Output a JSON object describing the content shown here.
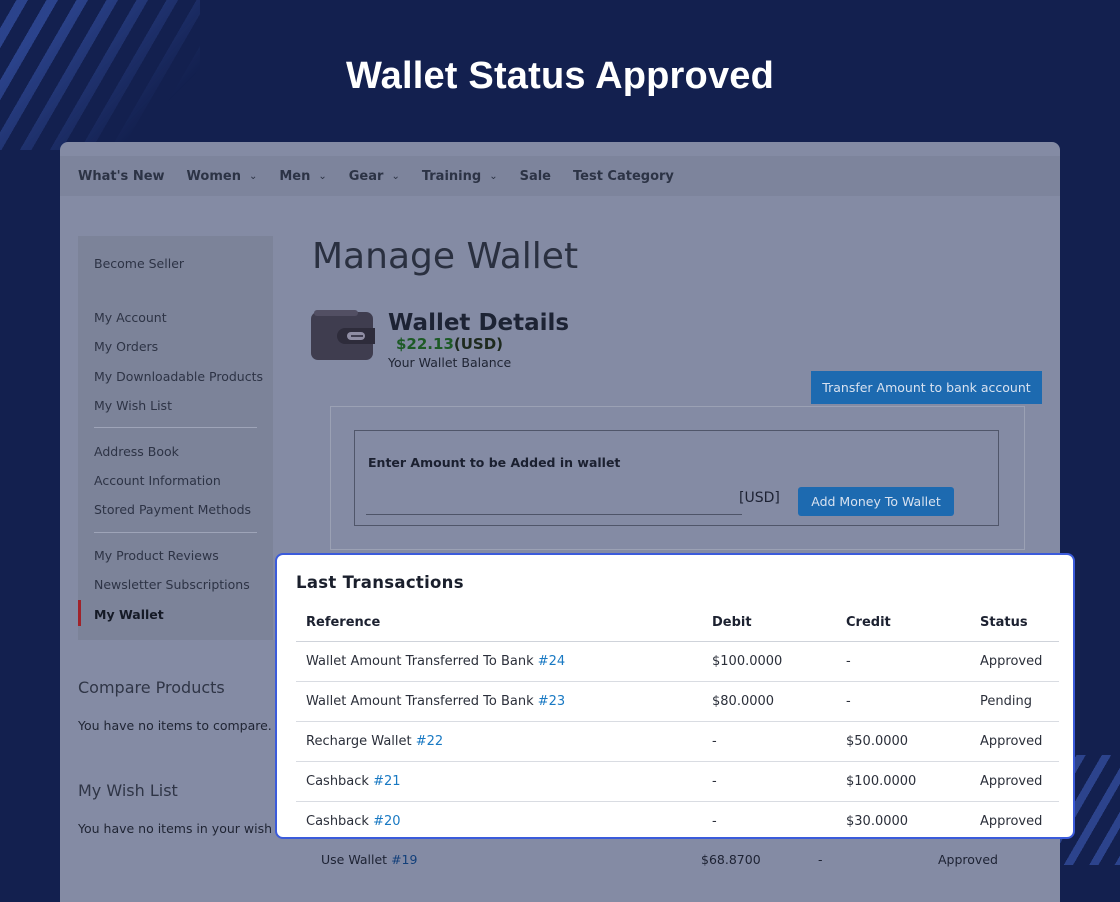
{
  "headline": "Wallet Status Approved",
  "nav": {
    "items": [
      {
        "label": "What's New",
        "dropdown": false
      },
      {
        "label": "Women",
        "dropdown": true
      },
      {
        "label": "Men",
        "dropdown": true
      },
      {
        "label": "Gear",
        "dropdown": true
      },
      {
        "label": "Training",
        "dropdown": true
      },
      {
        "label": "Sale",
        "dropdown": false
      },
      {
        "label": "Test Category",
        "dropdown": false
      }
    ]
  },
  "sidebar": {
    "become_seller": "Become Seller",
    "my_account": "My Account",
    "my_orders": "My Orders",
    "my_downloadable_products": "My Downloadable Products",
    "my_wish_list": "My Wish List",
    "address_book": "Address Book",
    "account_information": "Account Information",
    "stored_payment_methods": "Stored Payment Methods",
    "my_product_reviews": "My Product Reviews",
    "newsletter_subscriptions": "Newsletter Subscriptions",
    "my_wallet": "My Wallet"
  },
  "compare": {
    "heading": "Compare Products",
    "text": "You have no items to compare."
  },
  "wishlist": {
    "heading": "My Wish List",
    "text": "You have no items in your wish lis"
  },
  "page_title": "Manage Wallet",
  "wallet": {
    "title": "Wallet Details",
    "amount": "$22.13",
    "currency": "(USD)",
    "balance_label": "Your Wallet Balance",
    "transfer_button": "Transfer Amount to bank account",
    "amount_label": "Enter Amount to be Added in wallet",
    "amount_value": "",
    "usd_label": "[USD]",
    "add_button": "Add Money To Wallet"
  },
  "transactions": {
    "title": "Last Transactions",
    "headers": [
      "Reference",
      "Debit",
      "Credit",
      "Status"
    ],
    "rows": [
      {
        "ref": "Wallet Amount Transferred To Bank",
        "id": "#24",
        "debit": "$100.0000",
        "credit": "-",
        "status": "Approved"
      },
      {
        "ref": "Wallet Amount Transferred To Bank",
        "id": "#23",
        "debit": "$80.0000",
        "credit": "-",
        "status": "Pending"
      },
      {
        "ref": "Recharge Wallet",
        "id": "#22",
        "debit": "-",
        "credit": "$50.0000",
        "status": "Approved"
      },
      {
        "ref": "Cashback",
        "id": "#21",
        "debit": "-",
        "credit": "$100.0000",
        "status": "Approved"
      },
      {
        "ref": "Cashback",
        "id": "#20",
        "debit": "-",
        "credit": "$30.0000",
        "status": "Approved"
      }
    ],
    "dimmed_row": {
      "ref": "Use Wallet",
      "id": "#19",
      "debit": "$68.8700",
      "credit": "-",
      "status": "Approved"
    }
  },
  "colors": {
    "background": "#13204f",
    "highlight_border": "#3b5bdb",
    "link": "#1979c3",
    "button": "#1d6ab0"
  }
}
